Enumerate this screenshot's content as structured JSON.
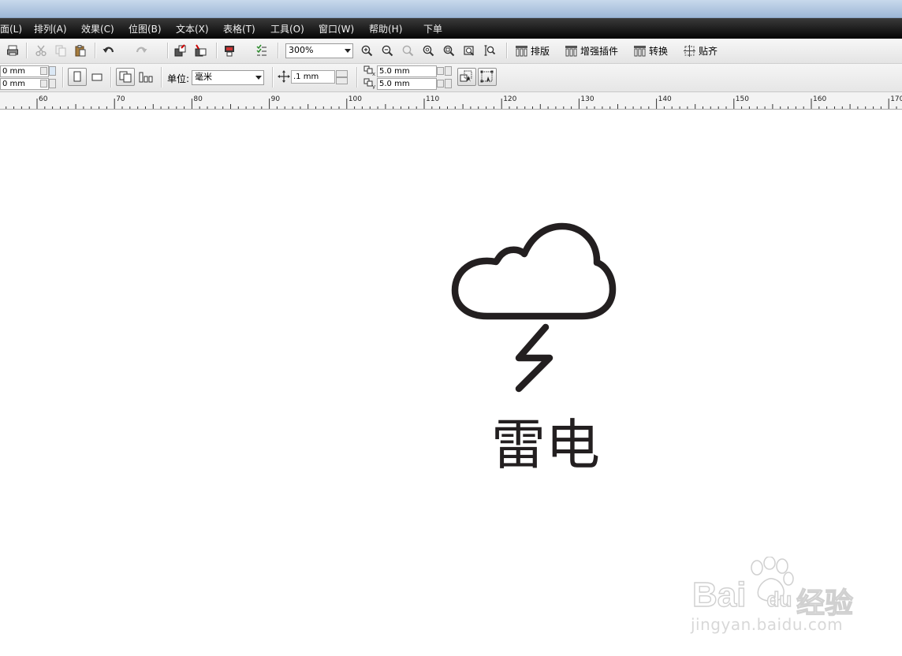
{
  "menu": {
    "items": [
      "面(L)",
      "排列(A)",
      "效果(C)",
      "位图(B)",
      "文本(X)",
      "表格(T)",
      "工具(O)",
      "窗口(W)",
      "帮助(H)",
      "下单"
    ]
  },
  "toolbar": {
    "zoom_value": "300%",
    "btn_layout": "排版",
    "btn_plugins": "增强插件",
    "btn_convert": "转换",
    "btn_align": "贴齐"
  },
  "propbar": {
    "size_w": "0 mm",
    "size_h": "0 mm",
    "unit_label": "单位:",
    "unit_value": "毫米",
    "nudge_value": ".1 mm",
    "dup_x": "5.0 mm",
    "dup_y": "5.0 mm"
  },
  "ruler": {
    "labels": [
      "60",
      "70",
      "80",
      "90",
      "100",
      "110",
      "120",
      "130",
      "140",
      "150",
      "160",
      "170"
    ]
  },
  "canvas": {
    "icon_caption": "雷电"
  },
  "watermark": {
    "brand": "Bai",
    "brand_suffix": "du",
    "product": "经验",
    "url": "jingyan.baidu.com"
  },
  "colors": {
    "menubar": "#1a1a1a",
    "icon_stroke": "#231f20",
    "canvas": "#ffffff"
  }
}
